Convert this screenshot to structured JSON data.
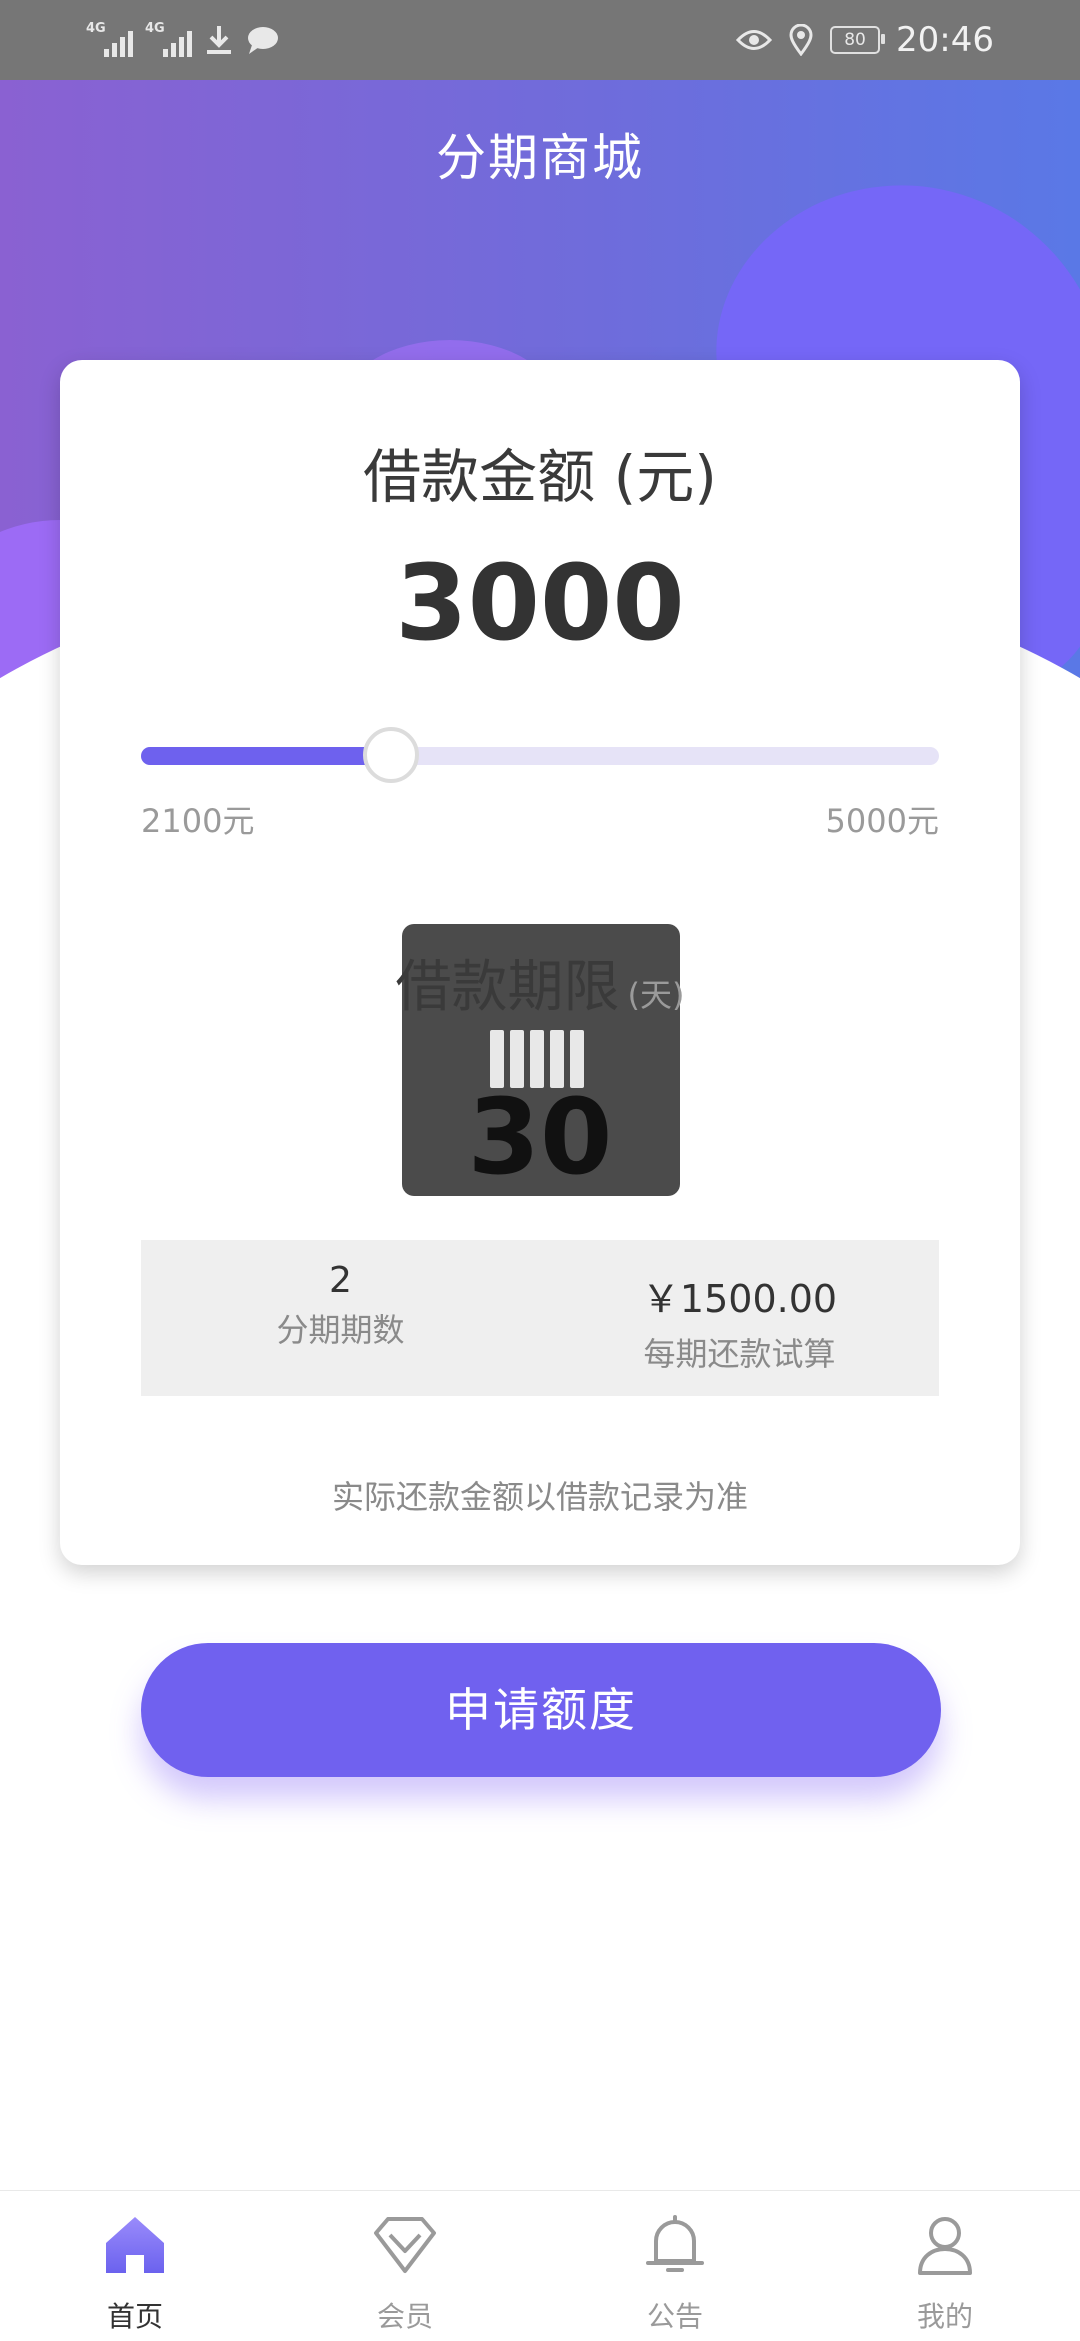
{
  "status_bar": {
    "signal1_type": "4G",
    "signal2_type": "4G",
    "battery": "80",
    "time": "20:46",
    "icons": [
      "download-icon",
      "message-icon",
      "eye-icon",
      "location-icon"
    ]
  },
  "header": {
    "title": "分期商城"
  },
  "loan": {
    "amount_label": "借款金额 (元)",
    "amount": "3000",
    "slider": {
      "min": 2100,
      "max": 5000,
      "value": 3000
    },
    "min_label": "2100元",
    "max_label": "5000元",
    "term_label": "借款期限",
    "term_unit": "(天)",
    "term_value": "30",
    "periods": "2",
    "periods_label": "分期期数",
    "payment": "￥1500.00",
    "payment_label": "每期还款试算",
    "disclaimer": "实际还款金额以借款记录为准"
  },
  "apply_button": "申请额度",
  "tabbar": {
    "items": [
      {
        "label": "首页",
        "icon": "home-icon",
        "active": true
      },
      {
        "label": "会员",
        "icon": "diamond-icon",
        "active": false
      },
      {
        "label": "公告",
        "icon": "bell-icon",
        "active": false
      },
      {
        "label": "我的",
        "icon": "user-icon",
        "active": false
      }
    ]
  },
  "colors": {
    "accent": "#7061ef",
    "tab_active": "#7b74f2",
    "tab_inactive": "#9a9a9a"
  }
}
